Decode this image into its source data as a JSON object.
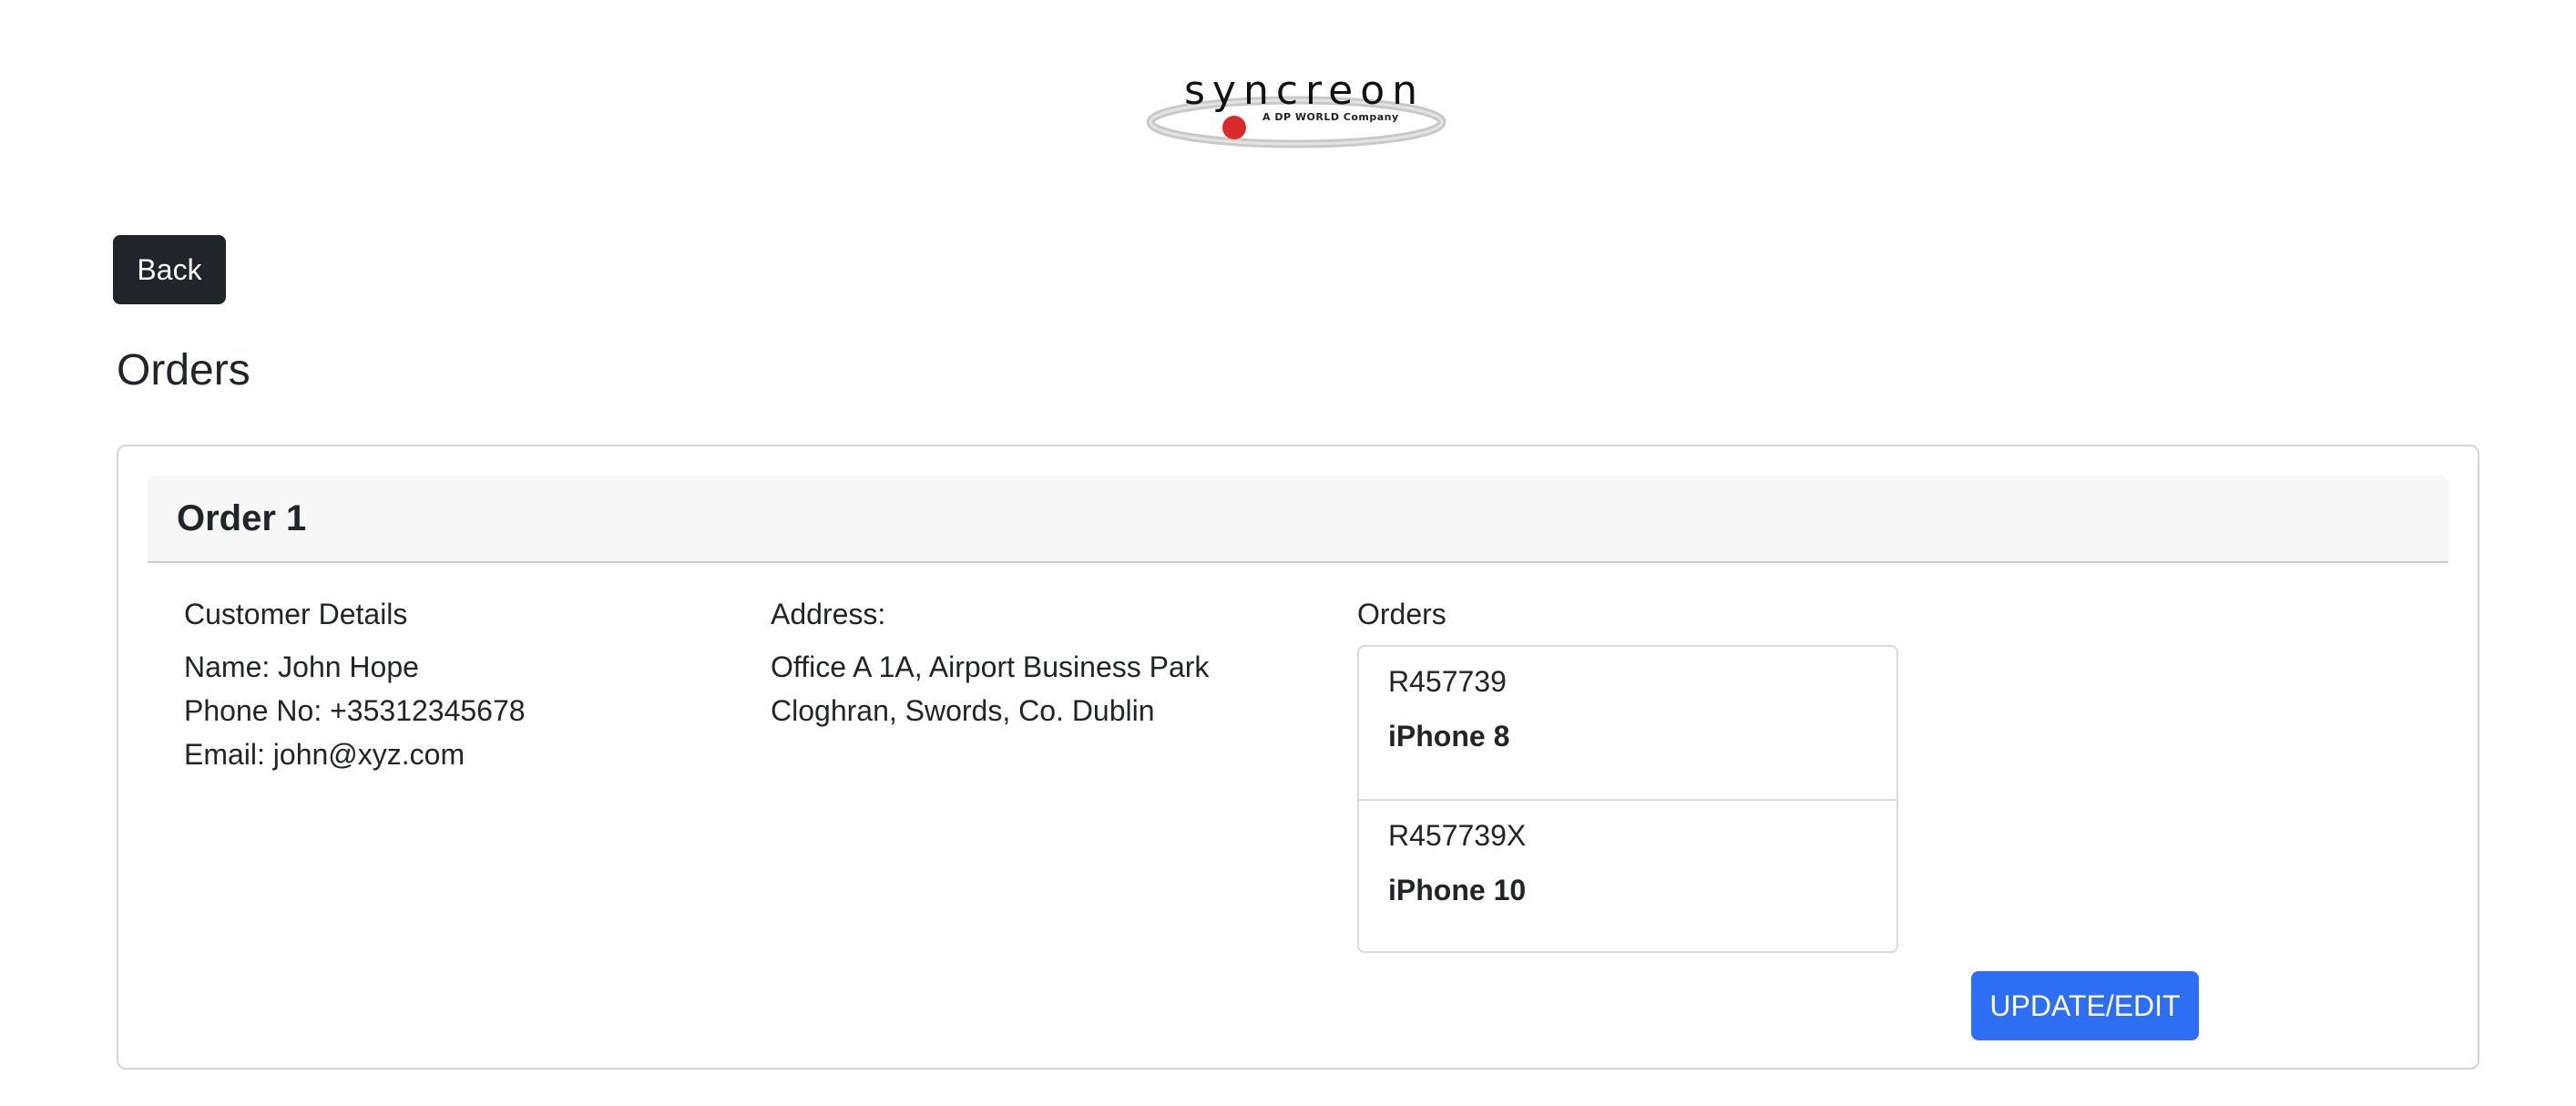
{
  "logo": {
    "brand": "syncreon",
    "tagline": "A DP WORLD Company",
    "accent_color": "#d92b2b"
  },
  "nav": {
    "back_label": "Back"
  },
  "page": {
    "title": "Orders"
  },
  "order": {
    "title": "Order 1",
    "customer": {
      "heading": "Customer Details",
      "name": "Name: John Hope",
      "phone": "Phone No: +35312345678",
      "email": "Email: john@xyz.com"
    },
    "address": {
      "heading": "Address:",
      "lines": [
        "Office A 1A, Airport Business Park",
        "Cloghran, Swords, Co. Dublin"
      ]
    },
    "orders": {
      "heading": "Orders",
      "items": [
        {
          "code": "R457739",
          "name": "iPhone 8"
        },
        {
          "code": "R457739X",
          "name": "iPhone 10"
        }
      ]
    },
    "update_label": "UPDATE/EDIT"
  },
  "colors": {
    "primary_button": "#2e6ef5",
    "dark_button": "#212529"
  }
}
